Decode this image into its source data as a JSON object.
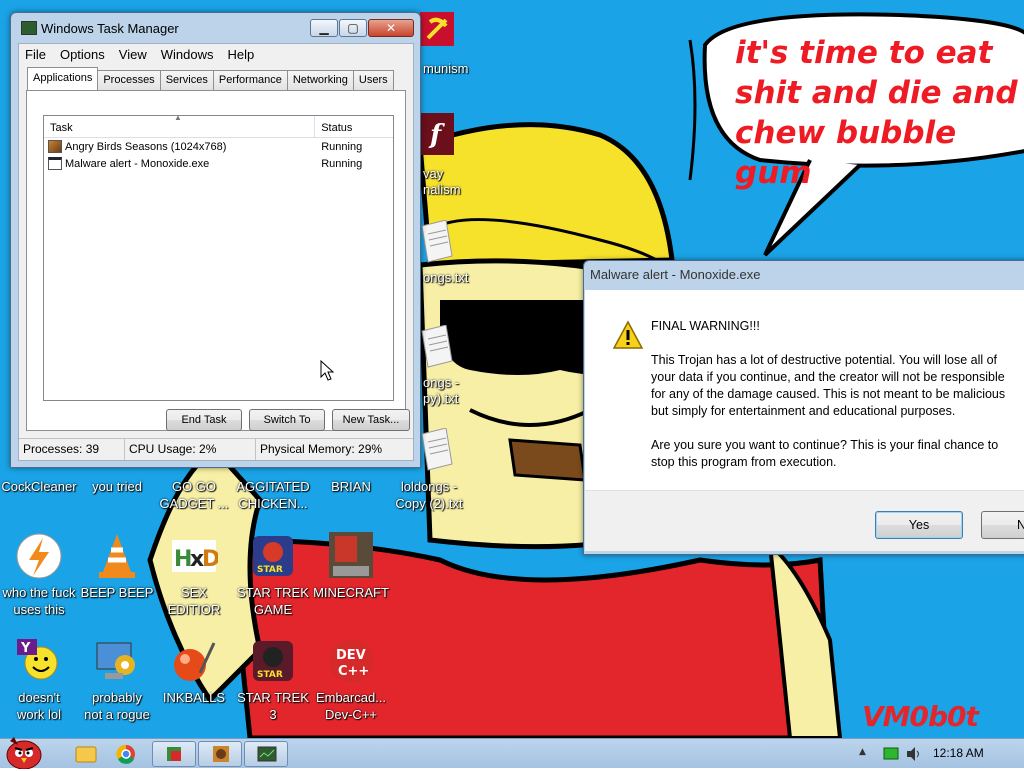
{
  "desktop": {
    "speech_text": "it's time to eat shit and die and chew bubble gum",
    "signature": "VM0b0t",
    "partial_labels": {
      "communism": "munism",
      "journalism_1": "vay",
      "journalism_2": "nalism",
      "longs": "ongs.txt",
      "copy_1": "ongs -",
      "copy_2": "py).txt"
    },
    "icons": [
      {
        "name": "cockcleaner",
        "label": "CockCleaner"
      },
      {
        "name": "you-tried",
        "label": "you tried"
      },
      {
        "name": "go-go-gadget",
        "label": "GO GO\nGADGET ..."
      },
      {
        "name": "aggitated-chicken",
        "label": "AGGITATED\nCHICKEN..."
      },
      {
        "name": "brian",
        "label": "BRIAN"
      },
      {
        "name": "loldongs-copy-2",
        "label": "loldongs -\nCopy (2).txt"
      },
      {
        "name": "who-the-fuck",
        "label": "who the fuck\nuses this"
      },
      {
        "name": "beep-beep",
        "label": "BEEP BEEP"
      },
      {
        "name": "sex-editior",
        "label": "SEX\nEDITIOR"
      },
      {
        "name": "star-trek-game",
        "label": "STAR TREK\nGAME"
      },
      {
        "name": "minecraft",
        "label": "MINECRAFT"
      },
      {
        "name": "doesnt-work",
        "label": "doesn't\nwork lol"
      },
      {
        "name": "probably-not-a-rogue",
        "label": "probably\nnot a rogue"
      },
      {
        "name": "inkballs",
        "label": "INKBALLS"
      },
      {
        "name": "star-trek-3",
        "label": "STAR TREK\n3"
      },
      {
        "name": "embarcadero",
        "label": "Embarcad...\nDev-C++"
      }
    ]
  },
  "task_manager": {
    "title": "Windows Task Manager",
    "menu": [
      "File",
      "Options",
      "View",
      "Windows",
      "Help"
    ],
    "tabs": [
      "Applications",
      "Processes",
      "Services",
      "Performance",
      "Networking",
      "Users"
    ],
    "columns": {
      "task": "Task",
      "status": "Status"
    },
    "rows": [
      {
        "task": "Angry Birds Seasons (1024x768)",
        "status": "Running"
      },
      {
        "task": "Malware alert - Monoxide.exe",
        "status": "Running"
      }
    ],
    "buttons": {
      "end_task": "End Task",
      "switch_to": "Switch To",
      "new_task": "New Task..."
    },
    "status": {
      "processes": "Processes: 39",
      "cpu": "CPU Usage: 2%",
      "memory": "Physical Memory: 29%"
    }
  },
  "malware_dialog": {
    "title": "Malware alert - Monoxide.exe",
    "heading": "FINAL WARNING!!!",
    "para1": [
      "This Trojan has a lot of destructive potential. You will lose all of",
      "your data if you continue, and the creator will not be responsible",
      "for any of the damage caused. This is not meant to be malicious",
      "but simply for entertainment and educational purposes."
    ],
    "para2": [
      "Are you sure you want to continue? This is your final chance to",
      "stop this program from execution."
    ],
    "yes": "Yes",
    "no": "No"
  },
  "taskbar": {
    "clock": "12:18 AM",
    "tray_chevron": "▲"
  },
  "colors": {
    "desktop_bg": "#1aa3e6",
    "speech_red": "#ee1b24",
    "cap_yellow": "#f7e22b",
    "skin": "#f6efa5",
    "shirt_red": "#e3262c"
  }
}
